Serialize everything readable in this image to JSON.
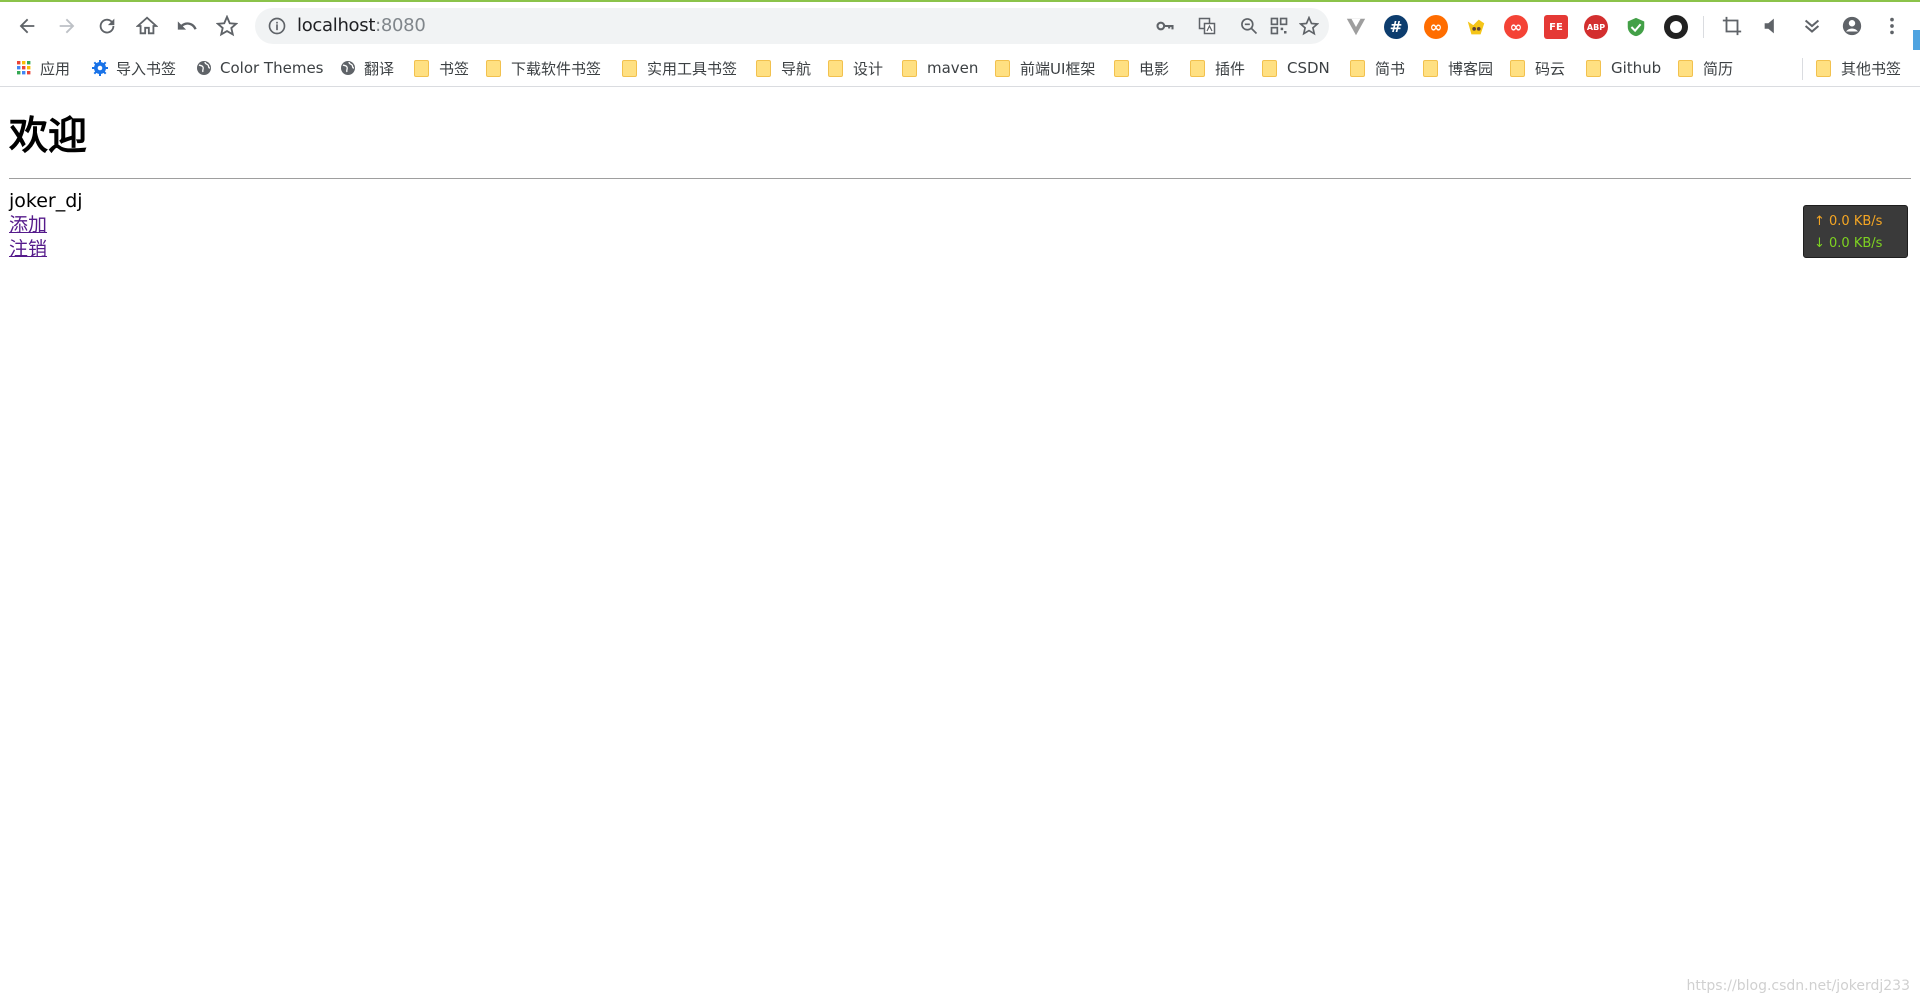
{
  "browser": {
    "address_bar": {
      "host": "localhost",
      "port": ":8080"
    },
    "bookmarks": [
      {
        "label": "应用",
        "icon": "apps-grid-icon"
      },
      {
        "label": "导入书签",
        "icon": "gear-icon"
      },
      {
        "label": "Color Themes",
        "icon": "globe-icon"
      },
      {
        "label": "翻译",
        "icon": "globe-icon"
      },
      {
        "label": "书签",
        "icon": "folder-icon"
      },
      {
        "label": "下载软件书签",
        "icon": "folder-icon"
      },
      {
        "label": "实用工具书签",
        "icon": "folder-icon"
      },
      {
        "label": "导航",
        "icon": "folder-icon"
      },
      {
        "label": "设计",
        "icon": "folder-icon"
      },
      {
        "label": "maven",
        "icon": "folder-icon"
      },
      {
        "label": "前端UI框架",
        "icon": "folder-icon"
      },
      {
        "label": "电影",
        "icon": "folder-icon"
      },
      {
        "label": "插件",
        "icon": "folder-icon"
      },
      {
        "label": "CSDN",
        "icon": "folder-icon"
      },
      {
        "label": "简书",
        "icon": "folder-icon"
      },
      {
        "label": "博客园",
        "icon": "folder-icon"
      },
      {
        "label": "码云",
        "icon": "folder-icon"
      },
      {
        "label": "Github",
        "icon": "folder-icon"
      },
      {
        "label": "简历",
        "icon": "folder-icon"
      }
    ],
    "other_bookmarks": "其他书签",
    "extensions": [
      {
        "name": "vue-devtools-icon",
        "color": "#9e9e9e",
        "glyph": ""
      },
      {
        "name": "hashtag-icon",
        "color": "#0d3d6e",
        "glyph": "#"
      },
      {
        "name": "infinity-orange-icon",
        "color": "#ff6d00",
        "glyph": "∞"
      },
      {
        "name": "tampermonkey-icon",
        "color": "#f5c518",
        "glyph": ""
      },
      {
        "name": "infinity-red-icon",
        "color": "#f44336",
        "glyph": "∞"
      },
      {
        "name": "fe-helper-icon",
        "color": "#e53935",
        "glyph": "FE"
      },
      {
        "name": "adblock-plus-icon",
        "color": "#d32f2f",
        "glyph": "ABP"
      },
      {
        "name": "shield-icon",
        "color": "#43a047",
        "glyph": ""
      },
      {
        "name": "record-icon",
        "color": "#212121",
        "glyph": ""
      }
    ]
  },
  "page": {
    "title": "欢迎",
    "username": "joker_dj",
    "links": {
      "add": "添加",
      "logout": "注销"
    }
  },
  "netspeed": {
    "up": "↑ 0.0 KB/s",
    "down": "↓ 0.0 KB/s"
  },
  "watermark": "https://blog.csdn.net/jokerdj233"
}
